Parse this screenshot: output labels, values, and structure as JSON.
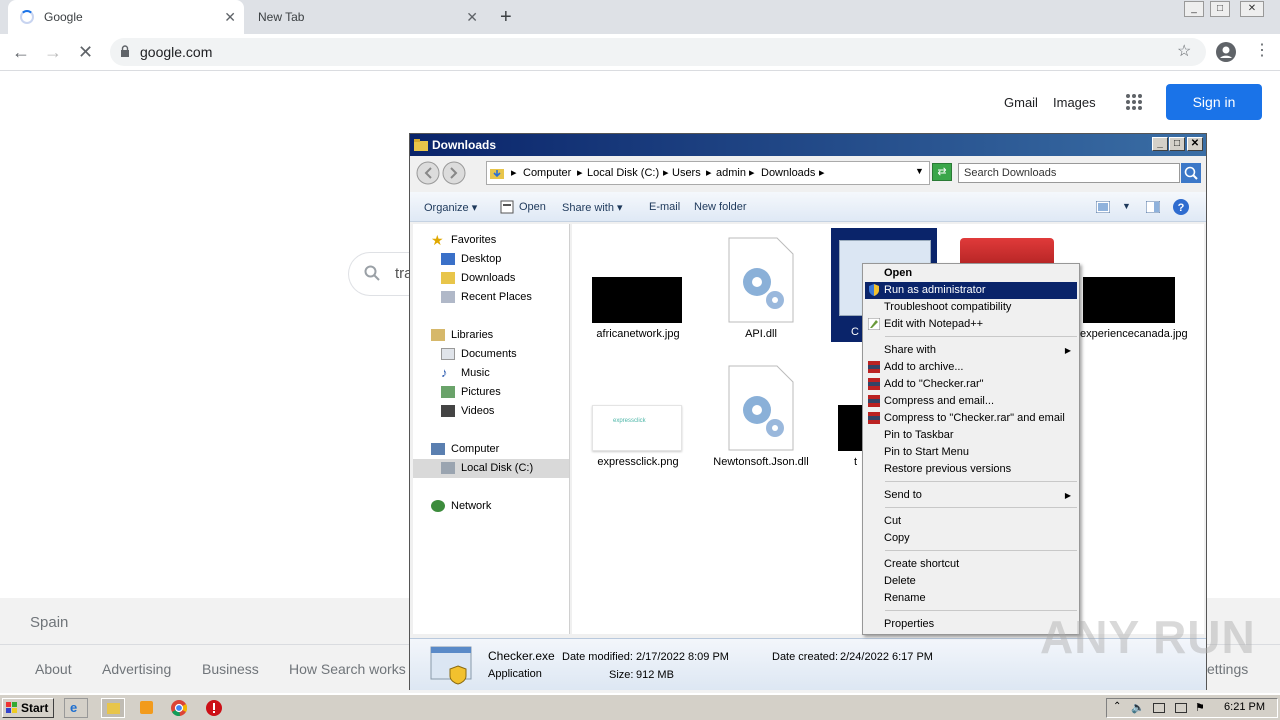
{
  "browser": {
    "tabs": [
      {
        "label": "Google"
      },
      {
        "label": "New Tab"
      }
    ],
    "new_tab": "+",
    "url": "google.com",
    "window_buttons": [
      "_",
      "□",
      "✕"
    ]
  },
  "google": {
    "gmail": "Gmail",
    "images": "Images",
    "sign_in": "Sign in",
    "search_value": "tra",
    "country": "Spain",
    "footer_links": [
      "About",
      "Advertising",
      "Business",
      "How Search works"
    ],
    "footer_right": "ettings"
  },
  "explorer": {
    "title": "Downloads",
    "breadcrumb": [
      "Computer",
      "Local Disk (C:)",
      "Users",
      "admin",
      "Downloads"
    ],
    "search_placeholder": "Search Downloads",
    "commands": [
      "Organize",
      "Open",
      "Share with",
      "E-mail",
      "New folder"
    ],
    "nav": {
      "favorites_header": "Favorites",
      "favorites": [
        "Desktop",
        "Downloads",
        "Recent Places"
      ],
      "libraries_header": "Libraries",
      "libraries": [
        "Documents",
        "Music",
        "Pictures",
        "Videos"
      ],
      "computer_header": "Computer",
      "computer": [
        "Local Disk (C:)"
      ],
      "network_header": "Network"
    },
    "files": [
      {
        "name": "africanetwork.jpg"
      },
      {
        "name": "API.dll"
      },
      {
        "name": "C"
      },
      {
        "name": "experiencecanada.jpg"
      },
      {
        "name": "expressclick.png"
      },
      {
        "name": "Newtonsoft.Json.dll"
      },
      {
        "name": "t"
      }
    ],
    "status": {
      "filename": "Checker.exe",
      "type": "Application",
      "modified_label": "Date modified:",
      "modified": "2/17/2022 8:09 PM",
      "created_label": "Date created:",
      "created": "2/24/2022 6:17 PM",
      "size_label": "Size:",
      "size": "912 MB"
    },
    "thumb_text": "expressclick"
  },
  "context_menu": {
    "items": [
      {
        "label": "Open",
        "bold": true
      },
      {
        "label": "Run as administrator",
        "highlight": true
      },
      {
        "label": "Troubleshoot compatibility"
      },
      {
        "label": "Edit with Notepad++"
      },
      {
        "label": "Share with"
      },
      {
        "label": "Add to archive..."
      },
      {
        "label": "Add to \"Checker.rar\""
      },
      {
        "label": "Compress and email..."
      },
      {
        "label": "Compress to \"Checker.rar\" and email"
      },
      {
        "label": "Pin to Taskbar"
      },
      {
        "label": "Pin to Start Menu"
      },
      {
        "label": "Restore previous versions"
      },
      {
        "label": "Send to"
      },
      {
        "label": "Cut"
      },
      {
        "label": "Copy"
      },
      {
        "label": "Create shortcut"
      },
      {
        "label": "Delete"
      },
      {
        "label": "Rename"
      },
      {
        "label": "Properties"
      }
    ]
  },
  "taskbar": {
    "start": "Start",
    "clock": "6:21 PM"
  },
  "watermark": "ANY RUN"
}
